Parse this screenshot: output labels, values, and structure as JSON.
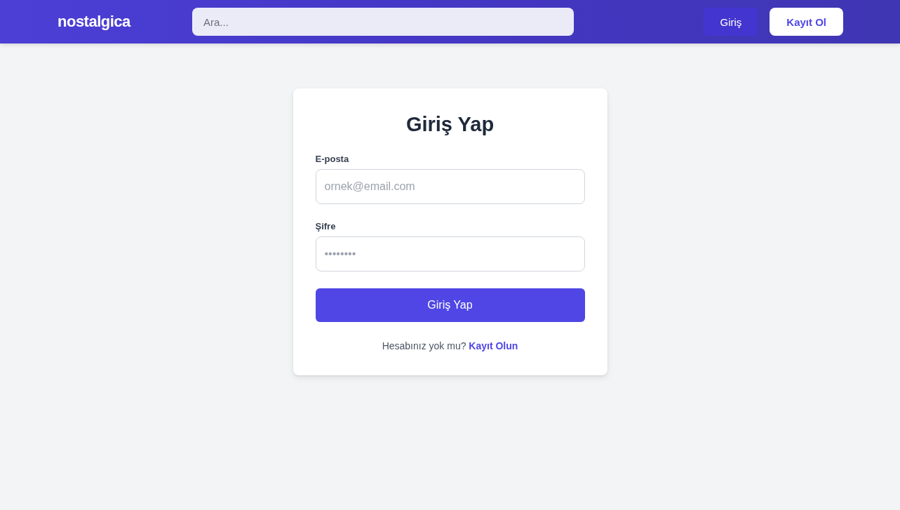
{
  "header": {
    "logo": "nostalgica",
    "search": {
      "placeholder": "Ara..."
    },
    "buttons": [
      {
        "label": "Giriş",
        "kind": "ghost"
      },
      {
        "label": "Kayıt Ol",
        "kind": "solid"
      }
    ]
  },
  "login_form": {
    "title": "Giriş Yap",
    "fields": [
      {
        "label": "E-posta",
        "placeholder": "ornek@email.com"
      },
      {
        "label": "Şifre",
        "placeholder": "••••••••"
      }
    ],
    "submit": "Giriş Yap",
    "footer": {
      "text": "Hesabınız yok mu?",
      "link": "Kayıt Olun"
    }
  }
}
